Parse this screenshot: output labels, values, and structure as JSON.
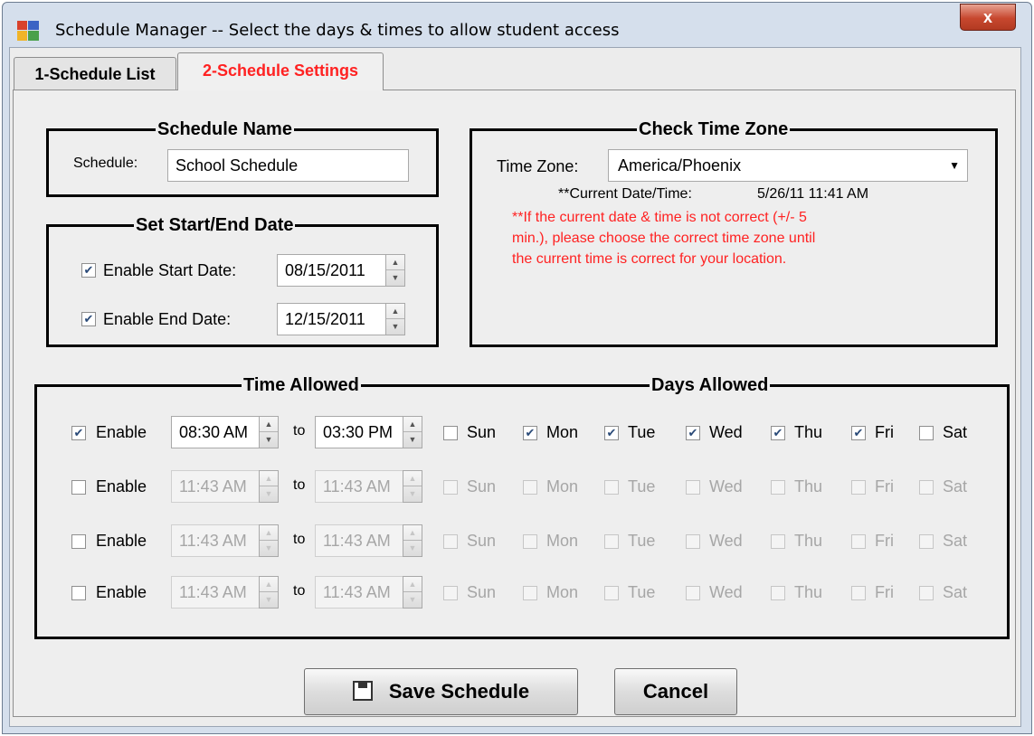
{
  "window": {
    "title": "Schedule Manager -- Select the days & times to allow student access",
    "close_label": "x"
  },
  "tabs": [
    {
      "label": "1-Schedule List"
    },
    {
      "label": "2-Schedule Settings"
    }
  ],
  "schedule_name": {
    "group_title": "Schedule Name",
    "field_label": "Schedule:",
    "value": "School Schedule"
  },
  "dates": {
    "group_title": "Set Start/End Date",
    "start_label": "Enable Start Date:",
    "start_value": "08/15/2011",
    "end_label": "Enable End Date:",
    "end_value": "12/15/2011"
  },
  "timezone": {
    "group_title": "Check Time Zone",
    "label": "Time Zone:",
    "value": "America/Phoenix",
    "current_label": "**Current Date/Time:",
    "current_value": "5/26/11 11:41 AM",
    "warning_line1": "**If the current date & time is not correct (+/- 5",
    "warning_line2": "min.), please choose the correct time zone until",
    "warning_line3": "the current time is correct for your location."
  },
  "time_section": {
    "time_title": "Time Allowed",
    "days_title": "Days Allowed",
    "to_label": "to",
    "enable_label": "Enable",
    "day_labels": [
      "Sun",
      "Mon",
      "Tue",
      "Wed",
      "Thu",
      "Fri",
      "Sat"
    ],
    "rows": [
      {
        "enabled": true,
        "start": "08:30 AM",
        "end": "03:30 PM"
      },
      {
        "enabled": false,
        "start": "11:43 AM",
        "end": "11:43 AM"
      },
      {
        "enabled": false,
        "start": "11:43 AM",
        "end": "11:43 AM"
      },
      {
        "enabled": false,
        "start": "11:43 AM",
        "end": "11:43 AM"
      }
    ]
  },
  "buttons": {
    "save": "Save Schedule",
    "cancel": "Cancel"
  },
  "colors": {
    "accent_red": "#ff2222"
  }
}
